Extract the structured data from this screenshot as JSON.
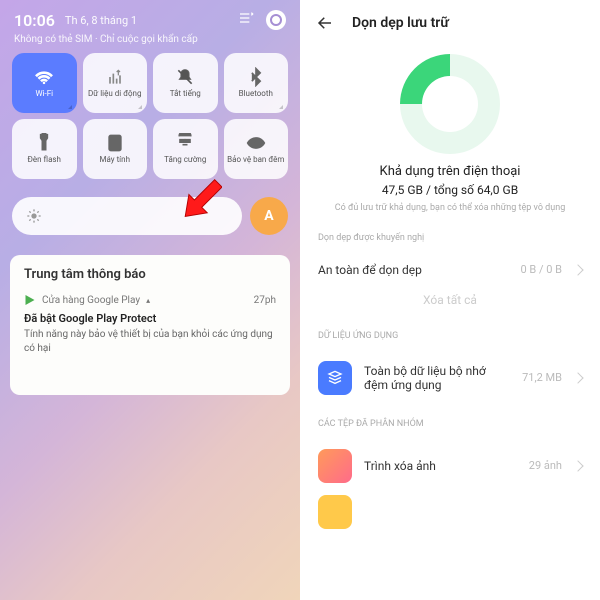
{
  "left": {
    "time": "10:06",
    "date": "Th 6, 8 tháng 1",
    "sim_status": "Không có thẻ SIM · Chỉ cuộc gọi khẩn cấp",
    "tiles": [
      {
        "label": "Wi-Fi",
        "icon": "wifi"
      },
      {
        "label": "Dữ liệu di động",
        "icon": "signal"
      },
      {
        "label": "Tắt tiếng",
        "icon": "bell-off"
      },
      {
        "label": "Bluetooth",
        "icon": "bluetooth"
      },
      {
        "label": "Đèn flash",
        "icon": "flashlight"
      },
      {
        "label": "Máy tính",
        "icon": "calculator"
      },
      {
        "label": "Tăng cường",
        "icon": "boost"
      },
      {
        "label": "Bảo vệ ban đêm",
        "icon": "eye"
      }
    ],
    "auto_brightness": "A",
    "notif": {
      "section": "Trung tâm thông báo",
      "source": "Cửa hàng Google Play",
      "time": "27ph",
      "title": "Đã bật Google Play Protect",
      "body": "Tính năng này bảo vệ thiết bị của bạn khỏi các ứng dụng có hại"
    }
  },
  "right": {
    "title": "Dọn dẹp lưu trữ",
    "avail_title": "Khả dụng trên điện thoại",
    "avail_value": "47,5 GB / tổng số 64,0 GB",
    "avail_note": "Có đủ lưu trữ khả dụng, bạn có thể xóa những tệp vô dụng",
    "section1_label": "Dọn dẹp được khuyến nghị",
    "safe_clean": "An toàn để dọn dẹp",
    "safe_value": "0 B / 0 B",
    "delete_all": "Xóa tất cả",
    "section2_label": "DỮ LIỆU ỨNG DỤNG",
    "cache_label": "Toàn bộ dữ liệu bộ nhớ đệm ứng dụng",
    "cache_value": "71,2 MB",
    "section3_label": "CÁC TỆP ĐÃ PHÂN NHÓM",
    "photo_label": "Trình xóa ảnh",
    "photo_value": "29 ảnh"
  }
}
